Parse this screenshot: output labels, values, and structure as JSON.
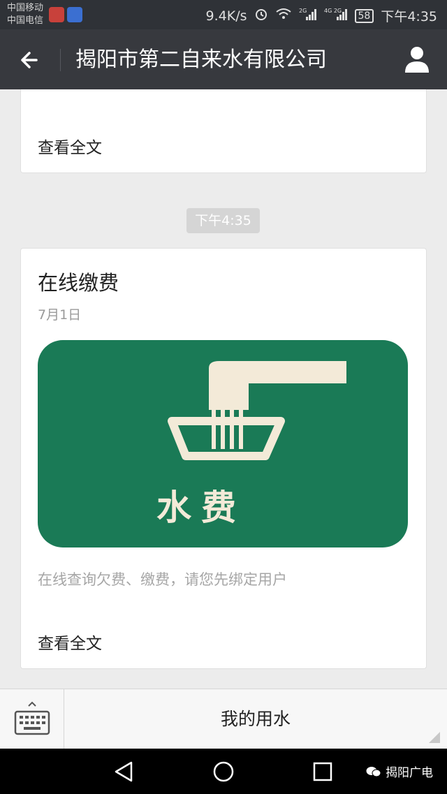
{
  "status_bar": {
    "carrier_1": "中国移动",
    "carrier_2": "中国电信",
    "net_speed": "9.4K/s",
    "alarm_icon": "alarm-icon",
    "wifi_icon": "wifi-icon",
    "signal_label_1": "2G",
    "signal_label_2": "4G 2G",
    "battery": "58",
    "time": "下午4:35"
  },
  "header": {
    "title": "揭阳市第二自来水有限公司",
    "back_icon": "back-arrow-icon",
    "profile_icon": "profile-icon"
  },
  "messages": [
    {
      "read_more": "查看全文"
    },
    {
      "timestamp": "下午4:35",
      "title": "在线缴费",
      "date": "7月1日",
      "cover_text": "水费",
      "description": "在线查询欠费、缴费，请您先绑定用户",
      "read_more": "查看全文"
    }
  ],
  "bottom_bar": {
    "keyboard_icon": "keyboard-icon",
    "menu_label": "我的用水"
  },
  "nav_bar": {
    "watermark": "揭阳广电"
  },
  "colors": {
    "cover_green": "#1a7a56",
    "cover_cream": "#f3ead8",
    "titlebar_bg": "#37393e"
  }
}
